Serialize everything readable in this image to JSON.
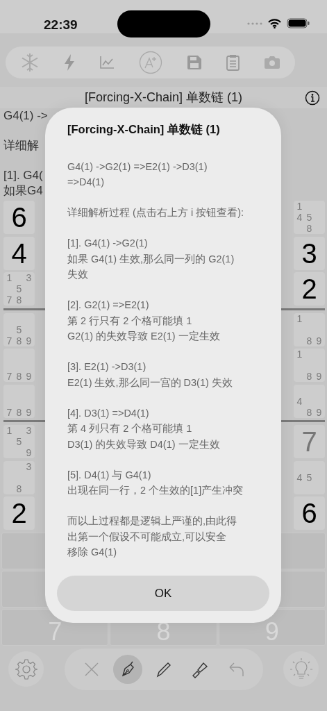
{
  "status_bar": {
    "time": "22:39"
  },
  "hint": {
    "title": "[Forcing-X-Chain] 单数链 (1)",
    "paragraphs": [
      [
        "G4(1) ->"
      ],
      [
        "详细解"
      ],
      [
        "[1]. G4(",
        "如果G4"
      ]
    ]
  },
  "grid": {
    "left_column": [
      {
        "kind": "given",
        "value": "6"
      },
      {
        "kind": "given",
        "value": "4"
      },
      {
        "kind": "notes",
        "notes": [
          "1",
          "3",
          "5",
          "7",
          "8"
        ]
      },
      {
        "kind": "notes",
        "notes": [
          "5",
          "7",
          "8",
          "9"
        ]
      },
      {
        "kind": "notes",
        "notes": [
          "7",
          "8",
          "9"
        ]
      },
      {
        "kind": "notes",
        "notes": [
          "7",
          "8",
          "9"
        ]
      },
      {
        "kind": "notes",
        "notes": [
          "1",
          "3",
          "5",
          "9"
        ]
      },
      {
        "kind": "notes",
        "notes": [
          "3",
          "8"
        ]
      },
      {
        "kind": "given",
        "value": "2"
      }
    ],
    "right_column": [
      {
        "kind": "notes",
        "notes": [
          "1",
          "4",
          "5",
          "8"
        ]
      },
      {
        "kind": "given",
        "value": "3"
      },
      {
        "kind": "given",
        "value": "2"
      },
      {
        "kind": "notes",
        "notes": [
          "1",
          "8",
          "9"
        ]
      },
      {
        "kind": "notes",
        "notes": [
          "1",
          "8",
          "9"
        ]
      },
      {
        "kind": "notes",
        "notes": [
          "4",
          "8",
          "9"
        ]
      },
      {
        "kind": "entered",
        "value": "7"
      },
      {
        "kind": "notes",
        "notes": [
          "4",
          "5"
        ]
      },
      {
        "kind": "given",
        "value": "6"
      }
    ]
  },
  "keypad": {
    "keys": [
      "7",
      "8",
      "9"
    ]
  },
  "tools": [
    {
      "kind": "erase",
      "selected": false
    },
    {
      "kind": "pen",
      "selected": true
    },
    {
      "kind": "pencil",
      "selected": false
    },
    {
      "kind": "brush",
      "selected": false
    },
    {
      "kind": "undo",
      "selected": false
    }
  ],
  "dialog": {
    "title": "[Forcing-X-Chain] 单数链 (1)",
    "paragraphs": [
      [
        "G4(1) ->G2(1) =>E2(1) ->D3(1)",
        "=>D4(1)"
      ],
      [
        "详细解析过程 (点击右上方 i 按钮查看):"
      ],
      [
        "[1]. G4(1) ->G2(1)",
        "如果 G4(1) 生效,那么同一列的 G2(1)",
        "失效"
      ],
      [
        "[2]. G2(1) =>E2(1)",
        "第 2 行只有 2 个格可能填 1",
        "G2(1) 的失效导致 E2(1) 一定生效"
      ],
      [
        "[3]. E2(1) ->D3(1)",
        "E2(1) 生效,那么同一宫的 D3(1) 失效"
      ],
      [
        "[4]. D3(1) =>D4(1)",
        "第 4 列只有 2 个格可能填 1",
        "D3(1) 的失效导致 D4(1) 一定生效"
      ],
      [
        "[5]. D4(1) 与 G4(1)",
        "出现在同一行，2 个生效的[1]产生冲突"
      ],
      [
        "而以上过程都是逻辑上严谨的,由此得",
        "出第一个假设不可能成立,可以安全",
        "移除 G4(1)"
      ]
    ],
    "button": "OK"
  }
}
